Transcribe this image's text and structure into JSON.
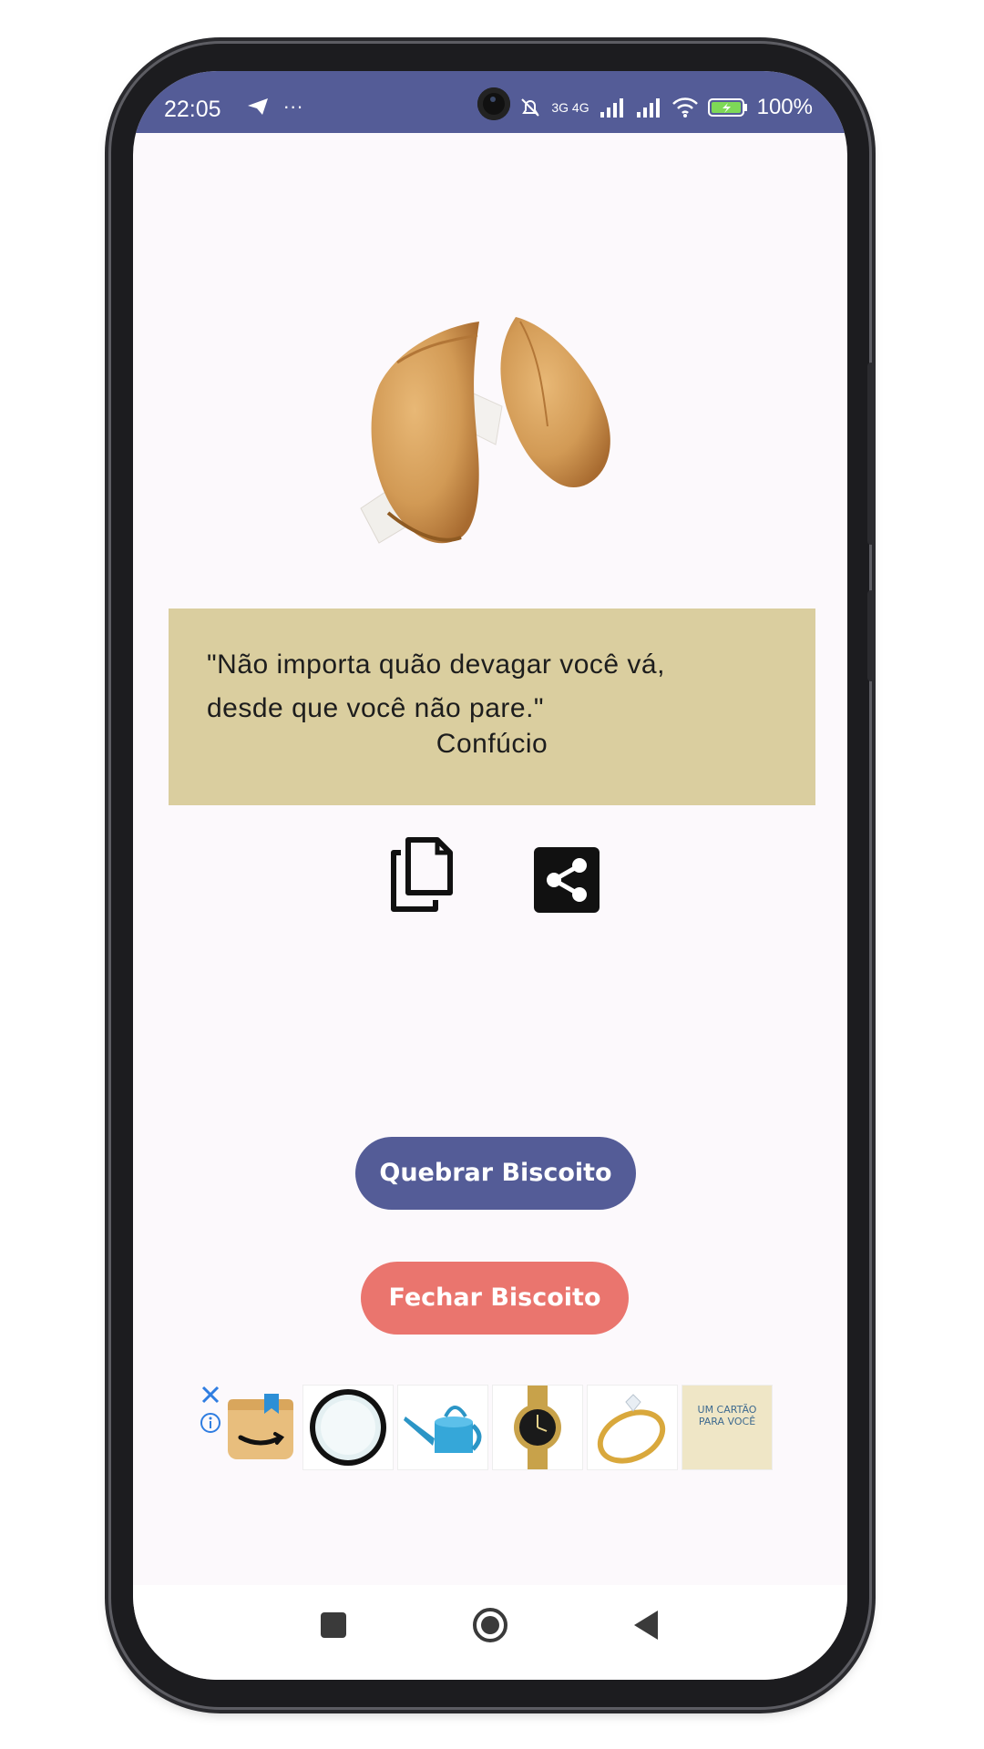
{
  "status_bar": {
    "time": "22:05",
    "left_icons": "◀ ···",
    "network": "3G 4G",
    "battery_percent": "100%"
  },
  "cookie": {
    "image": "fortune-cookie-broken"
  },
  "quote": {
    "text": "\"Não importa quão devagar você vá,\ndesde que você não pare.\"",
    "author": "Confúcio"
  },
  "actions": {
    "copy_icon": "copy-icon",
    "share_icon": "share-icon"
  },
  "buttons": {
    "primary": "Quebrar Biscoito",
    "secondary": "Fechar Biscoito"
  },
  "ad": {
    "items": [
      "amazon-logo",
      "round-mirror",
      "watering-can",
      "gold-watch",
      "gold-ring",
      "greeting-card"
    ],
    "card_text": "UM CARTÃO PARA VOCÊ"
  },
  "colors": {
    "primary": "#545c97",
    "secondary": "#ea756e",
    "quote_bg": "#dace9f",
    "screen_bg": "#fcf9fc"
  }
}
